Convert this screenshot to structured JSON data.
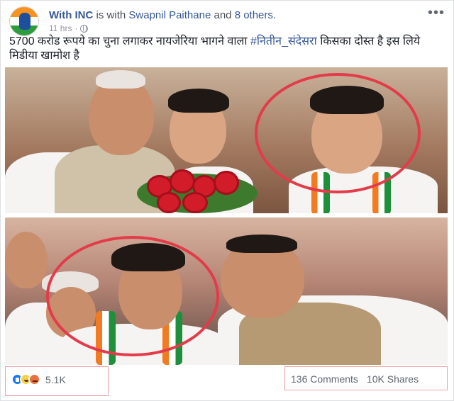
{
  "post": {
    "page_name": "With INC",
    "is_with_text": "is with",
    "tagged_person": "Swapnil Paithane",
    "and_text": "and",
    "others_text": "8 others.",
    "timestamp": "11 hrs",
    "privacy_icon": "globe-icon",
    "menu_icon": "more-options-icon",
    "caption_prefix": "5700 करोड रूपये का चुना लगाकर नायजेरिया भागने वाला",
    "hashtag": "#नितीन_संदेसरा",
    "caption_suffix": "किसका दोस्त है इस लिये मिडीया खामोश है"
  },
  "media": {
    "photos": [
      {
        "name": "top-photo",
        "highlight": "red-circle"
      },
      {
        "name": "bottom-photo",
        "highlight": "red-circle"
      }
    ]
  },
  "engagement": {
    "reaction_icons": [
      "like-icon",
      "haha-icon",
      "angry-icon"
    ],
    "reaction_count": "5.1K",
    "comments": "136 Comments",
    "shares": "10K Shares"
  },
  "colors": {
    "link": "#365899",
    "highlight_ring": "#e33b4a",
    "like": "#1877f2"
  }
}
